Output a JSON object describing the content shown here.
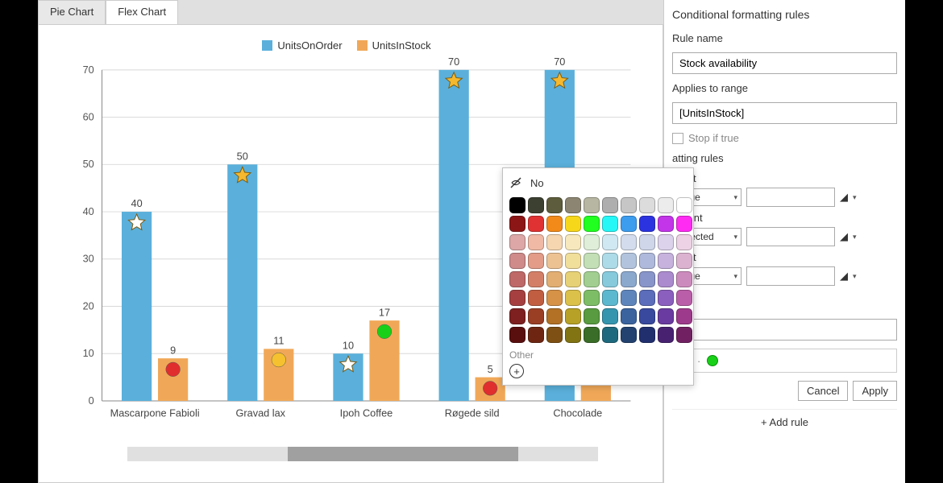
{
  "tabs": {
    "pie": "Pie Chart",
    "flex": "Flex Chart",
    "active": "flex"
  },
  "legend": [
    {
      "name": "UnitsOnOrder",
      "color": "#5ab0db"
    },
    {
      "name": "UnitsInStock",
      "color": "#f0a858"
    }
  ],
  "chart_data": {
    "type": "bar",
    "categories": [
      "Mascarpone Fabioli",
      "Gravad lax",
      "Ipoh Coffee",
      "Røgede sild",
      "Chocolade"
    ],
    "series": [
      {
        "name": "UnitsOnOrder",
        "values": [
          40,
          50,
          10,
          70,
          70
        ],
        "color": "#5ab0db",
        "markers": [
          "star-white",
          "star-gold",
          "star-white",
          "star-gold",
          "star-gold"
        ]
      },
      {
        "name": "UnitsInStock",
        "values": [
          9,
          11,
          17,
          5,
          6
        ],
        "color": "#f0a858",
        "markers": [
          "dot-red",
          "dot-gold",
          "dot-green",
          "dot-red",
          null
        ]
      }
    ],
    "ylim": [
      0,
      70
    ],
    "yticks": [
      0,
      10,
      20,
      30,
      40,
      50,
      60,
      70
    ],
    "xlabel": "",
    "ylabel": "",
    "title": ""
  },
  "panel": {
    "title": "Conditional formatting rules",
    "rule_name_label": "Rule name",
    "rule_name_value": "Stock availability",
    "applies_label": "Applies to range",
    "applies_value": "[UnitsInStock]",
    "stop_if_true": "Stop if true",
    "rules_header": "atting rules",
    "rows": [
      {
        "label": "Point",
        "select": "Value",
        "value": ""
      },
      {
        "label": "r Point",
        "select": "Selected",
        "value": ""
      },
      {
        "label": "Point",
        "select": "Value",
        "value": ""
      }
    ],
    "format_preview_label": "at",
    "cancel": "Cancel",
    "apply": "Apply",
    "add_rule": "+ Add rule"
  },
  "color_popup": {
    "no_label": "No",
    "other_label": "Other",
    "colors": [
      "#000000",
      "#3c4030",
      "#5d5d3d",
      "#8b8571",
      "#b6b6a2",
      "#aeaeae",
      "#c6c6c6",
      "#dcdcdc",
      "#ececec",
      "#ffffff",
      "#8c1616",
      "#e03232",
      "#f28a1a",
      "#f7d71a",
      "#20ff20",
      "#25f7f7",
      "#3c9def",
      "#2b33e0",
      "#c235e8",
      "#ff2bf3",
      "#dda7a7",
      "#f0b9a5",
      "#f5d6b0",
      "#f7e9bd",
      "#deeed8",
      "#d0e8f2",
      "#d2dcec",
      "#cfd6ea",
      "#ddd2ec",
      "#ecd2e4",
      "#cf8a8a",
      "#e29c87",
      "#edc293",
      "#f0de9b",
      "#c2dfb6",
      "#addbe8",
      "#b2c4dd",
      "#aeb9db",
      "#c6b2dd",
      "#dcb2d1",
      "#bf6868",
      "#d37f67",
      "#e2ae72",
      "#e7d176",
      "#a2cf91",
      "#86cadc",
      "#8ba8cd",
      "#8895ca",
      "#ab8bce",
      "#cc8bbd",
      "#a64040",
      "#c15e42",
      "#d69247",
      "#dbc14a",
      "#7dbd66",
      "#5cb8cf",
      "#5f86bc",
      "#5b6dbb",
      "#8b5fbe",
      "#bb5ea9",
      "#7e2020",
      "#9a3e24",
      "#b27125",
      "#b7a127",
      "#589b40",
      "#3595af",
      "#3b639e",
      "#38499e",
      "#6a3ba0",
      "#9e3a8b",
      "#5a0f0f",
      "#6e2612",
      "#7f5013",
      "#827313",
      "#3a6d27",
      "#1e697d",
      "#23426f",
      "#212f6f",
      "#482271",
      "#712162"
    ]
  }
}
